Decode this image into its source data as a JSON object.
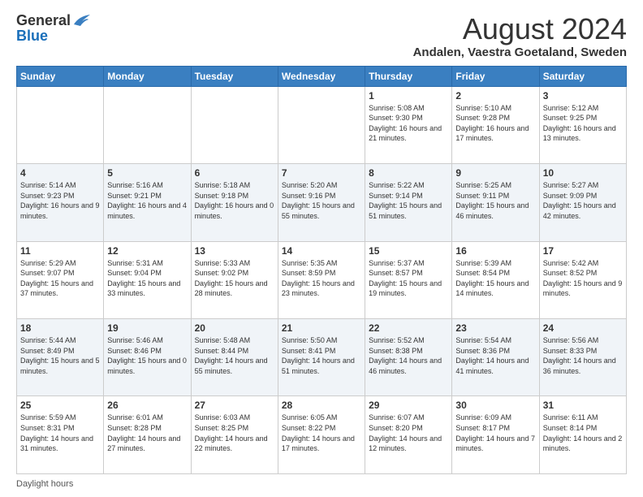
{
  "logo": {
    "general": "General",
    "blue": "Blue"
  },
  "title": "August 2024",
  "subtitle": "Andalen, Vaestra Goetaland, Sweden",
  "calendar": {
    "headers": [
      "Sunday",
      "Monday",
      "Tuesday",
      "Wednesday",
      "Thursday",
      "Friday",
      "Saturday"
    ],
    "weeks": [
      [
        {
          "day": "",
          "info": ""
        },
        {
          "day": "",
          "info": ""
        },
        {
          "day": "",
          "info": ""
        },
        {
          "day": "",
          "info": ""
        },
        {
          "day": "1",
          "info": "Sunrise: 5:08 AM\nSunset: 9:30 PM\nDaylight: 16 hours and 21 minutes."
        },
        {
          "day": "2",
          "info": "Sunrise: 5:10 AM\nSunset: 9:28 PM\nDaylight: 16 hours and 17 minutes."
        },
        {
          "day": "3",
          "info": "Sunrise: 5:12 AM\nSunset: 9:25 PM\nDaylight: 16 hours and 13 minutes."
        }
      ],
      [
        {
          "day": "4",
          "info": "Sunrise: 5:14 AM\nSunset: 9:23 PM\nDaylight: 16 hours and 9 minutes."
        },
        {
          "day": "5",
          "info": "Sunrise: 5:16 AM\nSunset: 9:21 PM\nDaylight: 16 hours and 4 minutes."
        },
        {
          "day": "6",
          "info": "Sunrise: 5:18 AM\nSunset: 9:18 PM\nDaylight: 16 hours and 0 minutes."
        },
        {
          "day": "7",
          "info": "Sunrise: 5:20 AM\nSunset: 9:16 PM\nDaylight: 15 hours and 55 minutes."
        },
        {
          "day": "8",
          "info": "Sunrise: 5:22 AM\nSunset: 9:14 PM\nDaylight: 15 hours and 51 minutes."
        },
        {
          "day": "9",
          "info": "Sunrise: 5:25 AM\nSunset: 9:11 PM\nDaylight: 15 hours and 46 minutes."
        },
        {
          "day": "10",
          "info": "Sunrise: 5:27 AM\nSunset: 9:09 PM\nDaylight: 15 hours and 42 minutes."
        }
      ],
      [
        {
          "day": "11",
          "info": "Sunrise: 5:29 AM\nSunset: 9:07 PM\nDaylight: 15 hours and 37 minutes."
        },
        {
          "day": "12",
          "info": "Sunrise: 5:31 AM\nSunset: 9:04 PM\nDaylight: 15 hours and 33 minutes."
        },
        {
          "day": "13",
          "info": "Sunrise: 5:33 AM\nSunset: 9:02 PM\nDaylight: 15 hours and 28 minutes."
        },
        {
          "day": "14",
          "info": "Sunrise: 5:35 AM\nSunset: 8:59 PM\nDaylight: 15 hours and 23 minutes."
        },
        {
          "day": "15",
          "info": "Sunrise: 5:37 AM\nSunset: 8:57 PM\nDaylight: 15 hours and 19 minutes."
        },
        {
          "day": "16",
          "info": "Sunrise: 5:39 AM\nSunset: 8:54 PM\nDaylight: 15 hours and 14 minutes."
        },
        {
          "day": "17",
          "info": "Sunrise: 5:42 AM\nSunset: 8:52 PM\nDaylight: 15 hours and 9 minutes."
        }
      ],
      [
        {
          "day": "18",
          "info": "Sunrise: 5:44 AM\nSunset: 8:49 PM\nDaylight: 15 hours and 5 minutes."
        },
        {
          "day": "19",
          "info": "Sunrise: 5:46 AM\nSunset: 8:46 PM\nDaylight: 15 hours and 0 minutes."
        },
        {
          "day": "20",
          "info": "Sunrise: 5:48 AM\nSunset: 8:44 PM\nDaylight: 14 hours and 55 minutes."
        },
        {
          "day": "21",
          "info": "Sunrise: 5:50 AM\nSunset: 8:41 PM\nDaylight: 14 hours and 51 minutes."
        },
        {
          "day": "22",
          "info": "Sunrise: 5:52 AM\nSunset: 8:38 PM\nDaylight: 14 hours and 46 minutes."
        },
        {
          "day": "23",
          "info": "Sunrise: 5:54 AM\nSunset: 8:36 PM\nDaylight: 14 hours and 41 minutes."
        },
        {
          "day": "24",
          "info": "Sunrise: 5:56 AM\nSunset: 8:33 PM\nDaylight: 14 hours and 36 minutes."
        }
      ],
      [
        {
          "day": "25",
          "info": "Sunrise: 5:59 AM\nSunset: 8:31 PM\nDaylight: 14 hours and 31 minutes."
        },
        {
          "day": "26",
          "info": "Sunrise: 6:01 AM\nSunset: 8:28 PM\nDaylight: 14 hours and 27 minutes."
        },
        {
          "day": "27",
          "info": "Sunrise: 6:03 AM\nSunset: 8:25 PM\nDaylight: 14 hours and 22 minutes."
        },
        {
          "day": "28",
          "info": "Sunrise: 6:05 AM\nSunset: 8:22 PM\nDaylight: 14 hours and 17 minutes."
        },
        {
          "day": "29",
          "info": "Sunrise: 6:07 AM\nSunset: 8:20 PM\nDaylight: 14 hours and 12 minutes."
        },
        {
          "day": "30",
          "info": "Sunrise: 6:09 AM\nSunset: 8:17 PM\nDaylight: 14 hours and 7 minutes."
        },
        {
          "day": "31",
          "info": "Sunrise: 6:11 AM\nSunset: 8:14 PM\nDaylight: 14 hours and 2 minutes."
        }
      ]
    ]
  },
  "footer": {
    "daylight_label": "Daylight hours"
  }
}
